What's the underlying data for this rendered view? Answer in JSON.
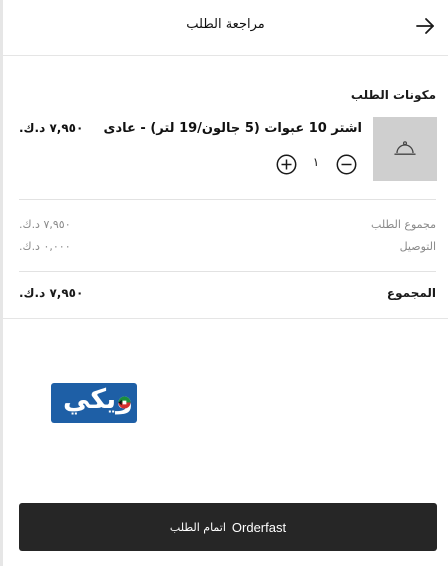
{
  "header": {
    "title": "مراجعة الطلب",
    "back_icon": "arrow-right-icon"
  },
  "order": {
    "section_title": "مكونات الطلب",
    "item": {
      "name": "اشتر 10 عبوات (5 جالون/19 لتر) - عادى",
      "price": "٧,٩٥٠ د.ك.",
      "quantity": "١",
      "thumbnail_icon": "cloche-icon"
    }
  },
  "summary": {
    "subtotal_label": "مجموع الطلب",
    "subtotal_value": "٧,٩٥٠ د.ك.",
    "delivery_label": "التوصيل",
    "delivery_value": "٠,٠٠٠ د.ك.",
    "total_label": "المجموع",
    "total_value": "٧,٩٥٠ د.ك."
  },
  "logo": {
    "text": "ويكي",
    "color": "#1e5fa6"
  },
  "checkout": {
    "brand": "Orderfast",
    "label": "اتمام الطلب"
  }
}
